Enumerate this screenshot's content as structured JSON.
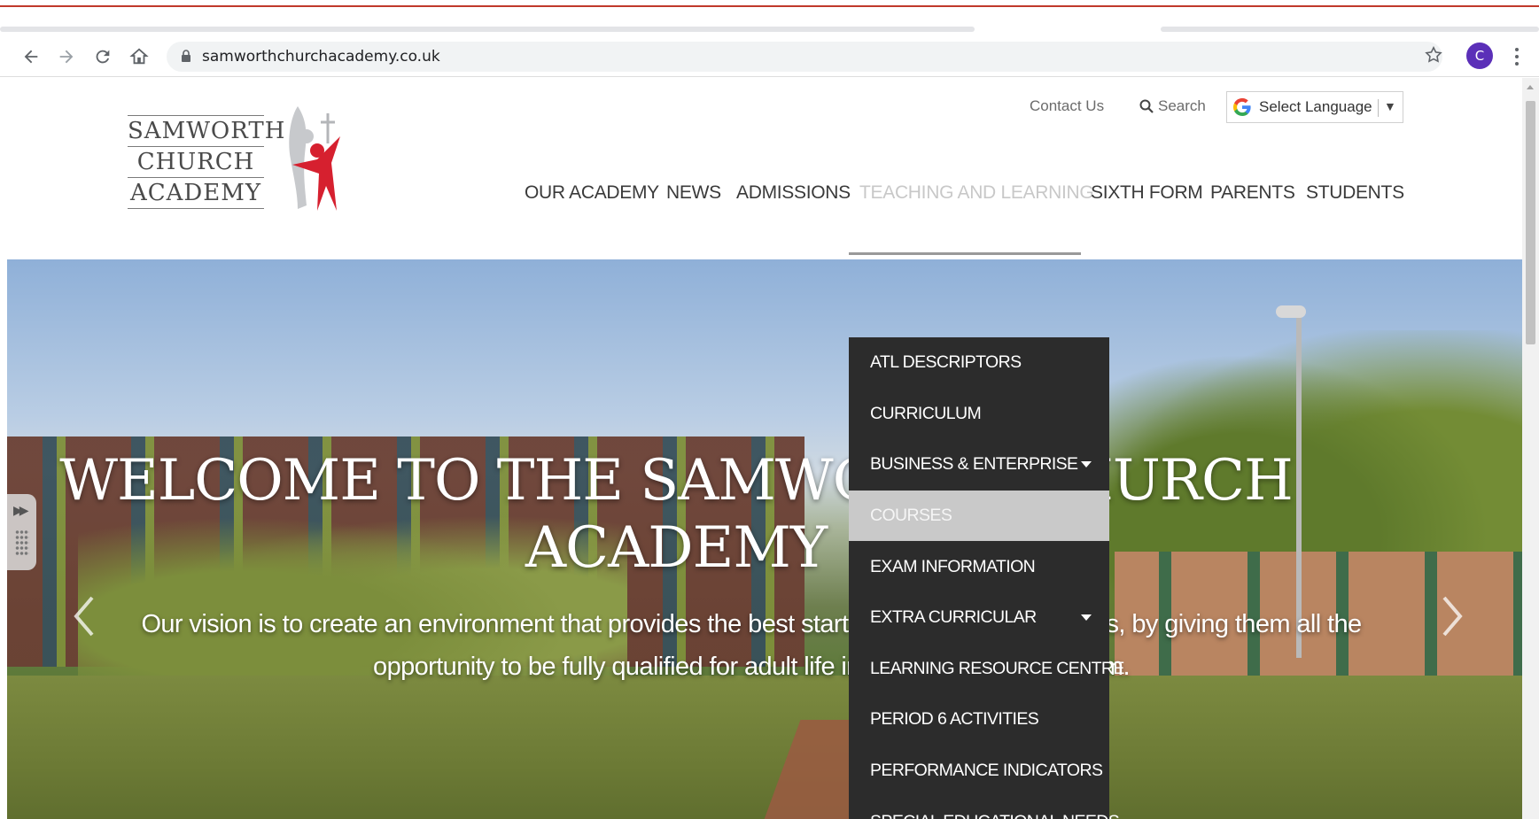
{
  "browser": {
    "url": "samworthchurchacademy.co.uk",
    "profile_initial": "C",
    "accent": "#5b2fb8"
  },
  "header": {
    "logo_lines": [
      "SAMWORTH",
      "CHURCH",
      "ACADEMY"
    ],
    "contact_label": "Contact Us",
    "search_label": "Search",
    "language_label": "Select Language",
    "language_arrow": "▼"
  },
  "nav": {
    "items": [
      {
        "label": "OUR ACADEMY"
      },
      {
        "label": "NEWS"
      },
      {
        "label": "ADMISSIONS"
      },
      {
        "label": "TEACHING AND LEARNING",
        "active": true
      },
      {
        "label": "SIXTH FORM"
      },
      {
        "label": "PARENTS"
      },
      {
        "label": "STUDENTS"
      }
    ]
  },
  "dropdown": {
    "items": [
      {
        "label": "ATL DESCRIPTORS"
      },
      {
        "label": "CURRICULUM"
      },
      {
        "label": "BUSINESS & ENTERPRISE",
        "submenu": true
      },
      {
        "label": "COURSES",
        "hover": true
      },
      {
        "label": "EXAM INFORMATION"
      },
      {
        "label": "EXTRA CURRICULAR",
        "submenu": true
      },
      {
        "label": "LEARNING RESOURCE CENTRE"
      },
      {
        "label": "PERIOD 6 ACTIVITIES"
      },
      {
        "label": "PERFORMANCE INDICATORS"
      },
      {
        "label": "SPECIAL EDUCATIONAL NEEDS"
      }
    ]
  },
  "hero": {
    "title": "WELCOME TO THE SAMWORTH CHURCH ACADEMY",
    "vision": "Our vision is to create an environment that provides the best start in life for all our students, by giving them all the opportunity to be fully qualified for adult life in every sense of the term."
  },
  "colors": {
    "brand_red": "#d6202f",
    "menu_bg": "#2c2c2c",
    "menu_hover": "#c9c9c9"
  }
}
